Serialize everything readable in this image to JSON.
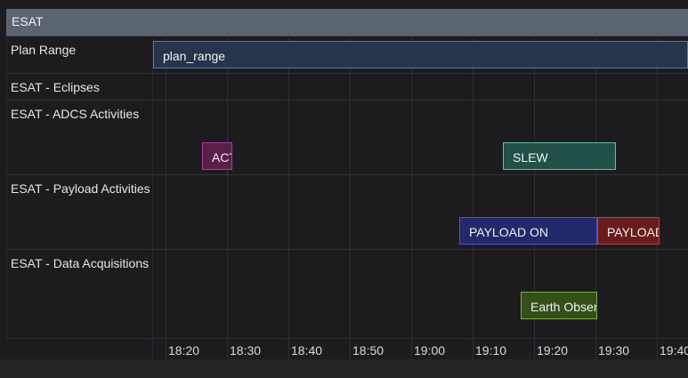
{
  "group": {
    "title": "ESAT"
  },
  "rows": [
    {
      "label": "Plan Range"
    },
    {
      "label": "ESAT - Eclipses"
    },
    {
      "label": "ESAT - ADCS Activities"
    },
    {
      "label": "ESAT - Payload Activities"
    },
    {
      "label": "ESAT - Data Acquisitions"
    }
  ],
  "time_ticks": [
    "18:20",
    "18:30",
    "18:40",
    "18:50",
    "19:00",
    "19:10",
    "19:20",
    "19:30",
    "19:40"
  ],
  "activities": {
    "plan_range": {
      "label": "plan_range",
      "color": "#26344d",
      "border": "#5577bb"
    },
    "act": {
      "label": "ACT",
      "color": "#5a1f47",
      "border": "#b03aa0"
    },
    "slew": {
      "label": "SLEW",
      "color": "#215048",
      "border": "#5cbfac"
    },
    "payload_on": {
      "label": "PAYLOAD ON",
      "color": "#22296b",
      "border": "#4a56d6"
    },
    "payload_2": {
      "label": "PAYLOAD",
      "color": "#6a1c1c",
      "border": "#c23a3a"
    },
    "earth_obs": {
      "label": "Earth Obser",
      "color": "#344f1a",
      "border": "#79a83e"
    }
  }
}
